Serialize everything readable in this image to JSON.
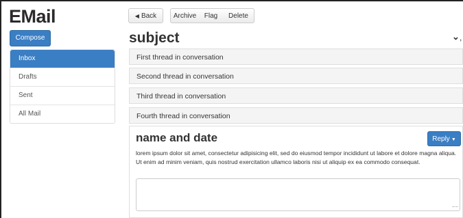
{
  "app": {
    "title": "EMail"
  },
  "sidebar": {
    "compose_label": "Compose",
    "items": [
      {
        "label": "Inbox",
        "active": true
      },
      {
        "label": "Drafts",
        "active": false
      },
      {
        "label": "Sent",
        "active": false
      },
      {
        "label": "All Mail",
        "active": false
      }
    ]
  },
  "toolbar": {
    "back_label": "Back",
    "archive_label": "Archive",
    "flag_label": "Flag",
    "delete_label": "Delete"
  },
  "conversation": {
    "subject": "subject",
    "threads": [
      "First thread in conversation",
      "Second thread in conversation",
      "Third thread in conversation",
      "Fourth thread in conversation"
    ]
  },
  "message": {
    "header": "name and date",
    "reply_label": "Reply",
    "body": "lorem ipsum dolor sit amet, consectetur adipisicing elit, sed do eiusmod tempor incididunt ut labore et dolore magna aliqua. Ut enim ad minim veniam, quis nostrud exercitation ullamco laboris nisi ut aliquip ex ea commodo consequat.",
    "reply_placeholder": ""
  },
  "colors": {
    "accent": "#3a7ec4",
    "thread_bg": "#f4f4f4"
  },
  "icons": {
    "back": "chevron-left-icon",
    "collapse": "chevron-down-icon",
    "reply_caret": "caret-down-icon",
    "resize": "resize-grip-icon"
  }
}
